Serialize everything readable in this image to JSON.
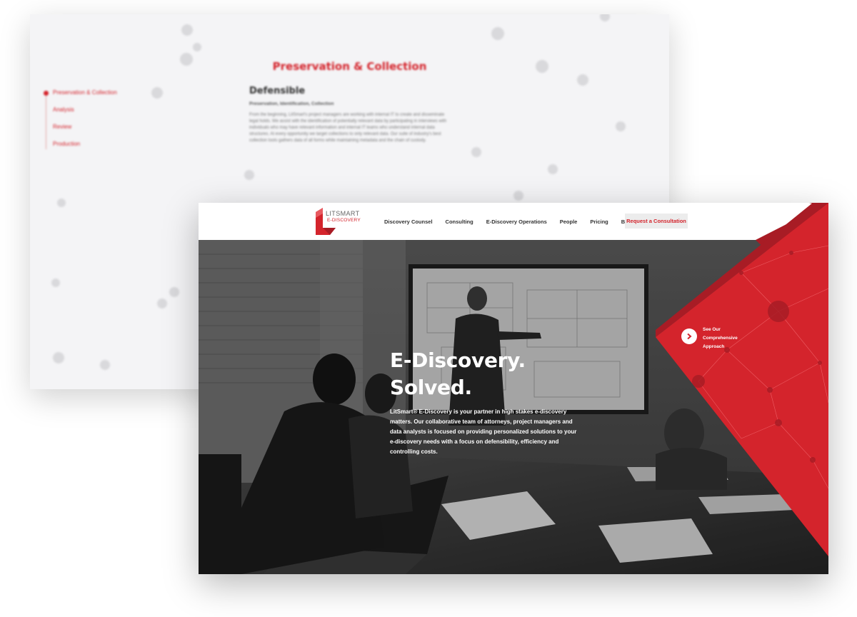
{
  "back_page": {
    "title": "Preservation & Collection",
    "sidebar": [
      {
        "label": "Preservation & Collection",
        "active": true
      },
      {
        "label": "Analysis",
        "active": false
      },
      {
        "label": "Review",
        "active": false
      },
      {
        "label": "Production",
        "active": false
      }
    ],
    "section_heading": "Defensible",
    "section_subheading": "Preservation, Identification, Collection",
    "section_body": "From the beginning, LitSmart's project managers are working with internal IT to create and disseminate legal holds. We assist with the identification of potentially relevant data by participating in interviews with individuals who may have relevant information and internal IT teams who understand internal data structures. At every opportunity we target collections to only relevant data. Our suite of industry's best collection tools gathers data of all forms while maintaining metadata and the chain of custody."
  },
  "front_page": {
    "logo": {
      "line1": "LITSMART",
      "line2": "E-DISCOVERY"
    },
    "nav": [
      "Discovery Counsel",
      "Consulting",
      "E-Discovery Operations",
      "People",
      "Pricing",
      "Blog"
    ],
    "cta_button": "Request a Consultation",
    "hero": {
      "title_line1": "E-Discovery.",
      "title_line2": "Solved.",
      "body": "LitSmart® E-Discovery is your partner in high stakes e-discovery matters. Our collaborative team of attorneys, project managers and data analysts is focused on providing personalized solutions to your e-discovery needs with a focus on defensibility, efficiency and controlling costs."
    },
    "approach_cta": {
      "line1": "See Our",
      "line2": "Comprehensive",
      "line3": "Approach"
    }
  },
  "colors": {
    "brand_red": "#d4242c",
    "dark_red": "#a81c25"
  }
}
